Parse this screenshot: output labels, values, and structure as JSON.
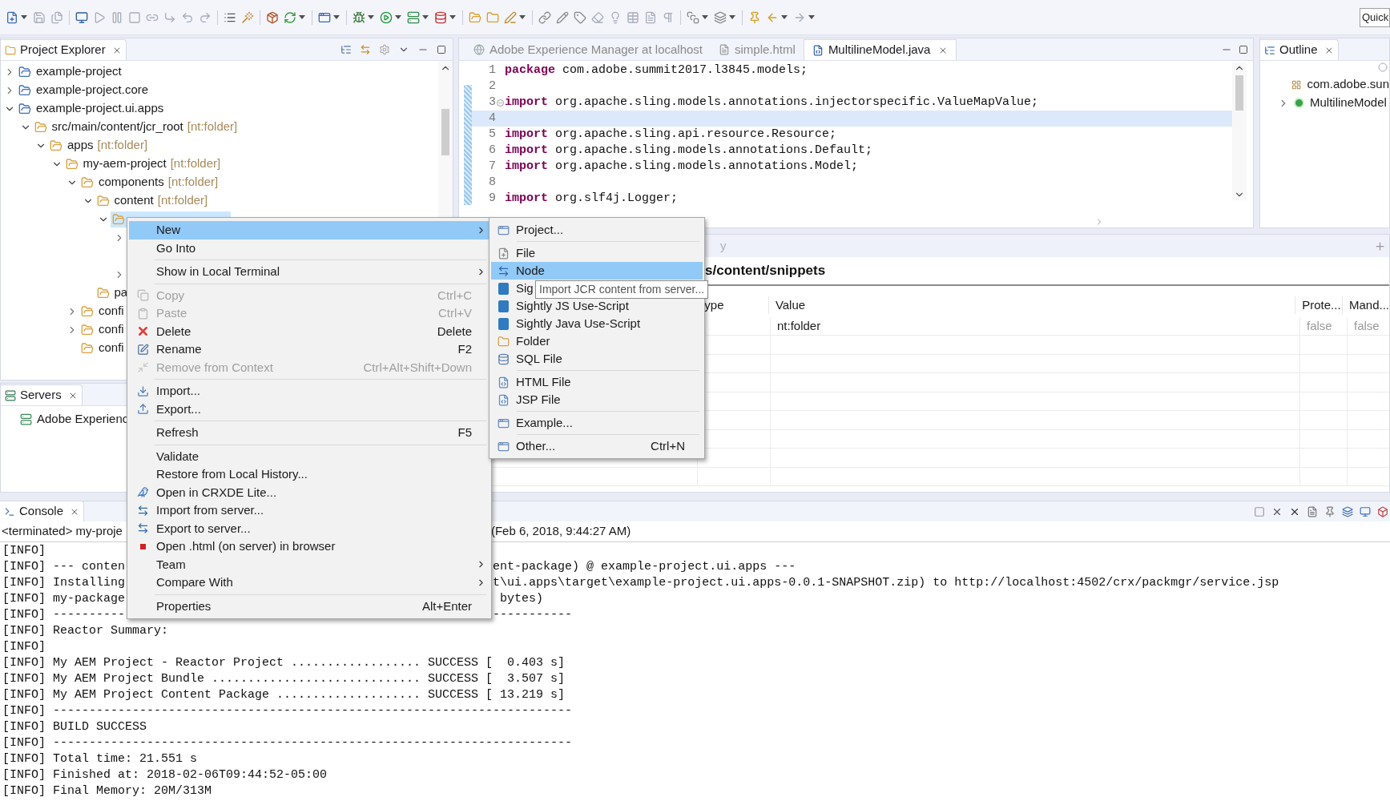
{
  "toolbar": {
    "quick_access": {
      "placeholder": "Quick"
    }
  },
  "project_explorer": {
    "title": "Project Explorer",
    "tree": [
      {
        "label": "example-project",
        "expanded": false,
        "selected": false
      },
      {
        "label": "example-project.core",
        "expanded": false,
        "selected": false
      },
      {
        "label": "example-project.ui.apps",
        "expanded": true,
        "selected": false,
        "children": [
          {
            "label": "src/main/content/jcr_root",
            "type_label": "[nt:folder]",
            "expanded": true,
            "selected": false,
            "children": [
              {
                "label": "apps",
                "type_label": "[nt:folder]",
                "expanded": true,
                "selected": false,
                "children": [
                  {
                    "label": "my-aem-project",
                    "type_label": "[nt:folder]",
                    "expanded": true,
                    "selected": false,
                    "children": [
                      {
                        "label": "components",
                        "type_label": "[nt:folder]",
                        "expanded": true,
                        "selected": false,
                        "children": [
                          {
                            "label": "content",
                            "type_label": "[nt:folder]",
                            "expanded": true,
                            "selected": false,
                            "children": [
                              {
                                "expanded": true,
                                "selected": true,
                                "children": [
                                  {
                                    "expanded": false,
                                    "selected": false
                                  },
                                  {
                                    "selected": false
                                  },
                                  {
                                    "expanded": false,
                                    "selected": false
                                  }
                                ]
                              }
                            ]
                          },
                          {
                            "label": "pa",
                            "selected": false
                          }
                        ]
                      },
                      {
                        "label": "confi",
                        "expanded": false,
                        "selected": false
                      },
                      {
                        "label": "confi",
                        "expanded": false,
                        "selected": false
                      },
                      {
                        "label": "confi",
                        "selected": false
                      }
                    ]
                  }
                ]
              }
            ]
          }
        ]
      }
    ]
  },
  "editor": {
    "tabs": [
      {
        "label": "Adobe Experience Manager at localhost",
        "selected": false
      },
      {
        "label": "simple.html",
        "selected": false
      },
      {
        "label": "MultilineModel.java",
        "selected": true
      }
    ],
    "lines": [
      {
        "number": "1",
        "keyword": "package",
        "code": " com.adobe.summit2017.l3845.models;",
        "current": false,
        "foldable": false
      },
      {
        "number": "2",
        "current": false,
        "foldable": false
      },
      {
        "number": "3",
        "keyword": "import",
        "code": " org.apache.sling.models.annotations.injectorspecific.ValueMapValue;",
        "current": false,
        "foldable": true
      },
      {
        "number": "4",
        "current": true,
        "foldable": false
      },
      {
        "number": "5",
        "keyword": "import",
        "code": " org.apache.sling.api.resource.Resource;",
        "current": false,
        "foldable": false
      },
      {
        "number": "6",
        "keyword": "import",
        "code": " org.apache.sling.models.annotations.Default;",
        "current": false,
        "foldable": false
      },
      {
        "number": "7",
        "keyword": "import",
        "code": " org.apache.sling.models.annotations.Model;",
        "current": false,
        "foldable": false
      },
      {
        "number": "8",
        "current": false,
        "foldable": false
      },
      {
        "number": "9",
        "keyword": "import",
        "code": " org.slf4j.Logger;",
        "current": false,
        "foldable": false
      }
    ]
  },
  "outline": {
    "title": "Outline",
    "items": [
      {
        "kind": "package",
        "label": "com.adobe.sun"
      },
      {
        "kind": "class",
        "label": "MultilineModel",
        "expanded": false
      }
    ]
  },
  "properties": {
    "tab_label": "y",
    "path": "s/content/snippets",
    "columns": [
      "ype",
      "Value",
      "Prote...",
      "Mand..."
    ],
    "rows": [
      {
        "value": "nt:folder",
        "protected": "false",
        "mandatory": "false"
      }
    ]
  },
  "servers": {
    "title": "Servers",
    "items": [
      {
        "label": "Adobe Experienc"
      }
    ]
  },
  "console": {
    "title": "Console",
    "process": "<terminated> my-proje",
    "started": "(Feb 6, 2018, 9:44:27 AM)",
    "lines": [
      {
        "kind": "full",
        "text": "[INFO]"
      },
      {
        "kind": "split",
        "left": "[INFO] --- conten",
        "right": "ent-package) @ example-project.ui.apps ---"
      },
      {
        "kind": "split",
        "left": "[INFO] Installing",
        "right": "t\\ui.apps\\target\\example-project.ui.apps-0.0.1-SNAPSHOT.zip) to http://localhost:4502/crx/packmgr/service.jsp"
      },
      {
        "kind": "split",
        "left": "[INFO] my-package",
        "right": " bytes)"
      },
      {
        "kind": "split",
        "left": "[INFO] ----------",
        "right": "-----------"
      },
      {
        "kind": "full",
        "text": "[INFO] Reactor Summary:"
      },
      {
        "kind": "full",
        "text": "[INFO]"
      },
      {
        "kind": "full",
        "text": "[INFO] My AEM Project - Reactor Project .................. SUCCESS [  0.403 s]"
      },
      {
        "kind": "full",
        "text": "[INFO] My AEM Project Bundle ............................. SUCCESS [  3.507 s]"
      },
      {
        "kind": "full",
        "text": "[INFO] My AEM Project Content Package .................... SUCCESS [ 13.219 s]"
      },
      {
        "kind": "full",
        "text": "[INFO] ------------------------------------------------------------------------"
      },
      {
        "kind": "full",
        "text": "[INFO] BUILD SUCCESS"
      },
      {
        "kind": "full",
        "text": "[INFO] ------------------------------------------------------------------------"
      },
      {
        "kind": "full",
        "text": "[INFO] Total time: 21.551 s"
      },
      {
        "kind": "full",
        "text": "[INFO] Finished at: 2018-02-06T09:44:52-05:00"
      },
      {
        "kind": "full",
        "text": "[INFO] Final Memory: 20M/313M"
      }
    ]
  },
  "context_menu": {
    "items": [
      {
        "kind": "item",
        "label": "New",
        "selected": true,
        "disabled": false,
        "submenu": true
      },
      {
        "kind": "item",
        "label": "Go Into",
        "selected": false,
        "disabled": false,
        "submenu": false
      },
      {
        "kind": "separator"
      },
      {
        "kind": "item",
        "label": "Show in Local Terminal",
        "selected": false,
        "disabled": false,
        "submenu": true
      },
      {
        "kind": "separator"
      },
      {
        "kind": "item",
        "label": "Copy",
        "shortcut": "Ctrl+C",
        "selected": false,
        "disabled": true,
        "submenu": false
      },
      {
        "kind": "item",
        "label": "Paste",
        "shortcut": "Ctrl+V",
        "selected": false,
        "disabled": true,
        "submenu": false
      },
      {
        "kind": "item",
        "label": "Delete",
        "shortcut": "Delete",
        "selected": false,
        "disabled": false,
        "submenu": false
      },
      {
        "kind": "item",
        "label": "Rename",
        "shortcut": "F2",
        "selected": false,
        "disabled": false,
        "submenu": false
      },
      {
        "kind": "item",
        "label": "Remove from Context",
        "shortcut": "Ctrl+Alt+Shift+Down",
        "selected": false,
        "disabled": true,
        "submenu": false
      },
      {
        "kind": "separator"
      },
      {
        "kind": "item",
        "label": "Import...",
        "selected": false,
        "disabled": false,
        "submenu": false
      },
      {
        "kind": "item",
        "label": "Export...",
        "selected": false,
        "disabled": false,
        "submenu": false
      },
      {
        "kind": "separator"
      },
      {
        "kind": "item",
        "label": "Refresh",
        "shortcut": "F5",
        "selected": false,
        "disabled": false,
        "submenu": false
      },
      {
        "kind": "separator"
      },
      {
        "kind": "item",
        "label": "Validate",
        "selected": false,
        "disabled": false,
        "submenu": false
      },
      {
        "kind": "item",
        "label": "Restore from Local History...",
        "selected": false,
        "disabled": false,
        "submenu": false
      },
      {
        "kind": "item",
        "label": "Open in CRXDE Lite...",
        "selected": false,
        "disabled": false,
        "submenu": false
      },
      {
        "kind": "item",
        "label": "Import from server...",
        "selected": false,
        "disabled": false,
        "submenu": false
      },
      {
        "kind": "item",
        "label": "Export to server...",
        "selected": false,
        "disabled": false,
        "submenu": false
      },
      {
        "kind": "item",
        "label": "Open .html (on server) in browser",
        "selected": false,
        "disabled": false,
        "submenu": false
      },
      {
        "kind": "item",
        "label": "Team",
        "selected": false,
        "disabled": false,
        "submenu": true
      },
      {
        "kind": "item",
        "label": "Compare With",
        "selected": false,
        "disabled": false,
        "submenu": true
      },
      {
        "kind": "separator"
      },
      {
        "kind": "item",
        "label": "Properties",
        "shortcut": "Alt+Enter",
        "selected": false,
        "disabled": false,
        "submenu": false
      }
    ]
  },
  "submenu": {
    "items": [
      {
        "kind": "item",
        "label": "Project...",
        "selected": false
      },
      {
        "kind": "separator"
      },
      {
        "kind": "item",
        "label": "File",
        "selected": false
      },
      {
        "kind": "item",
        "label": "Node",
        "selected": true
      },
      {
        "kind": "item",
        "label": "Sig",
        "selected": false
      },
      {
        "kind": "item",
        "label": "Sightly JS Use-Script",
        "selected": false
      },
      {
        "kind": "item",
        "label": "Sightly Java Use-Script",
        "selected": false
      },
      {
        "kind": "item",
        "label": "Folder",
        "selected": false
      },
      {
        "kind": "item",
        "label": "SQL File",
        "selected": false
      },
      {
        "kind": "separator"
      },
      {
        "kind": "item",
        "label": "HTML File",
        "selected": false
      },
      {
        "kind": "item",
        "label": "JSP File",
        "selected": false
      },
      {
        "kind": "separator"
      },
      {
        "kind": "item",
        "label": "Example...",
        "selected": false
      },
      {
        "kind": "separator"
      },
      {
        "kind": "item",
        "label": "Other...",
        "shortcut": "Ctrl+N",
        "selected": false
      }
    ]
  },
  "tooltip": {
    "text": "Import JCR content from server..."
  }
}
